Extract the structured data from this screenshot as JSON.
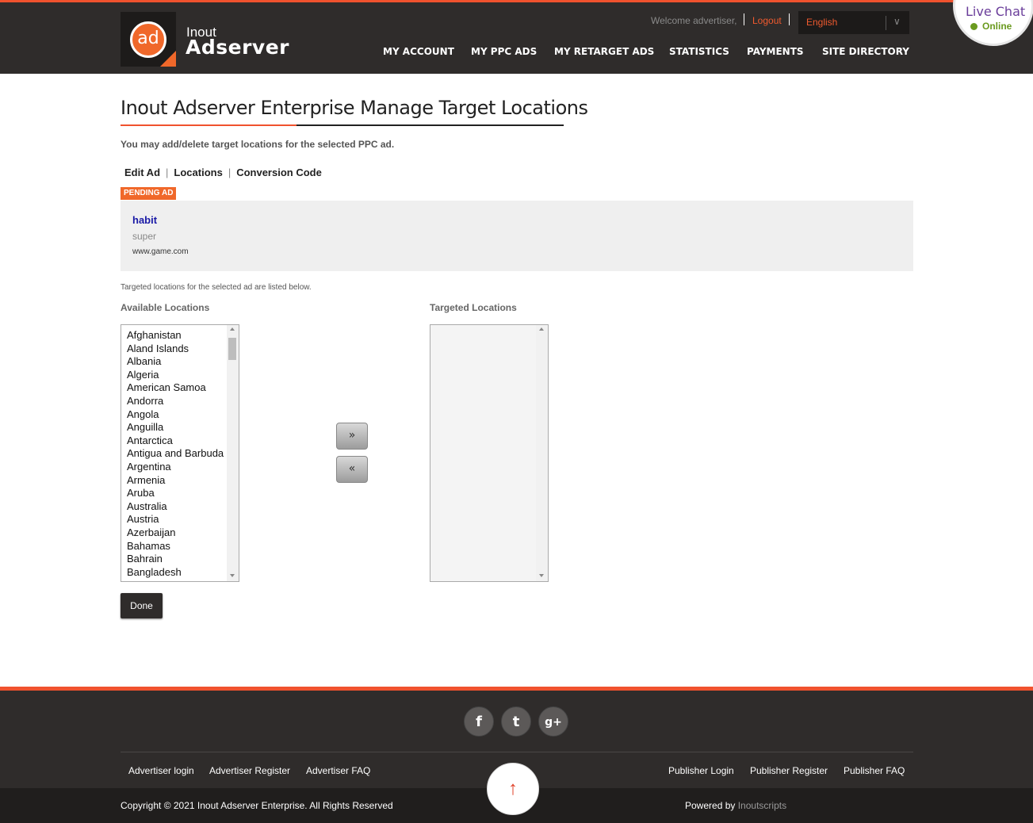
{
  "header": {
    "logo_small": "Inout",
    "logo_big": "Adserver",
    "logo_mark": "ad",
    "welcome": "Welcome advertiser,",
    "logout": "Logout",
    "language": "English",
    "nav": [
      "MY ACCOUNT",
      "MY PPC ADS",
      "MY RETARGET ADS",
      "STATISTICS",
      "PAYMENTS",
      "SITE DIRECTORY"
    ]
  },
  "livechat": {
    "title": "Live Chat",
    "status": "Online"
  },
  "main": {
    "title": "Inout Adserver Enterprise Manage Target Locations",
    "subtitle": "You may add/delete target locations for the selected PPC ad.",
    "tabs": [
      "Edit Ad",
      "Locations",
      "Conversion Code"
    ],
    "badge": "PENDING AD",
    "ad": {
      "title": "habit",
      "description": "super",
      "url": "www.game.com"
    },
    "note": "Targeted locations for the selected ad are listed below.",
    "available_label": "Available Locations",
    "targeted_label": "Targeted Locations",
    "available": [
      "Afghanistan",
      "Aland Islands",
      "Albania",
      "Algeria",
      "American Samoa",
      "Andorra",
      "Angola",
      "Anguilla",
      "Antarctica",
      "Antigua and Barbuda",
      "Argentina",
      "Armenia",
      "Aruba",
      "Australia",
      "Austria",
      "Azerbaijan",
      "Bahamas",
      "Bahrain",
      "Bangladesh"
    ],
    "add_glyph": "»",
    "remove_glyph": "«",
    "done": "Done"
  },
  "footer": {
    "social": [
      "f",
      "t",
      "g+"
    ],
    "links_left": [
      "Advertiser login",
      "Advertiser Register",
      "Advertiser FAQ"
    ],
    "links_right": [
      "Publisher Login",
      "Publisher Register",
      "Publisher FAQ"
    ],
    "copyright": "Copyright © 2021 Inout Adserver Enterprise. All Rights Reserved",
    "powered_by": "Powered by",
    "powered_brand": "Inoutscripts",
    "to_top": "↑"
  },
  "colors": {
    "accent": "#f0522e",
    "dark": "#2f2c2b",
    "link_blue": "#1a1aa6",
    "online_green": "#6a9a1f"
  }
}
